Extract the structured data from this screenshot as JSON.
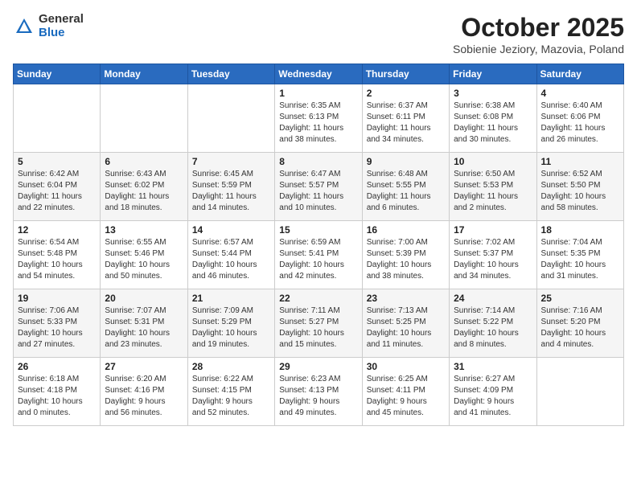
{
  "header": {
    "logo_general": "General",
    "logo_blue": "Blue",
    "month_title": "October 2025",
    "location": "Sobienie Jeziory, Mazovia, Poland"
  },
  "weekdays": [
    "Sunday",
    "Monday",
    "Tuesday",
    "Wednesday",
    "Thursday",
    "Friday",
    "Saturday"
  ],
  "weeks": [
    [
      {
        "day": "",
        "info": ""
      },
      {
        "day": "",
        "info": ""
      },
      {
        "day": "",
        "info": ""
      },
      {
        "day": "1",
        "info": "Sunrise: 6:35 AM\nSunset: 6:13 PM\nDaylight: 11 hours\nand 38 minutes."
      },
      {
        "day": "2",
        "info": "Sunrise: 6:37 AM\nSunset: 6:11 PM\nDaylight: 11 hours\nand 34 minutes."
      },
      {
        "day": "3",
        "info": "Sunrise: 6:38 AM\nSunset: 6:08 PM\nDaylight: 11 hours\nand 30 minutes."
      },
      {
        "day": "4",
        "info": "Sunrise: 6:40 AM\nSunset: 6:06 PM\nDaylight: 11 hours\nand 26 minutes."
      }
    ],
    [
      {
        "day": "5",
        "info": "Sunrise: 6:42 AM\nSunset: 6:04 PM\nDaylight: 11 hours\nand 22 minutes."
      },
      {
        "day": "6",
        "info": "Sunrise: 6:43 AM\nSunset: 6:02 PM\nDaylight: 11 hours\nand 18 minutes."
      },
      {
        "day": "7",
        "info": "Sunrise: 6:45 AM\nSunset: 5:59 PM\nDaylight: 11 hours\nand 14 minutes."
      },
      {
        "day": "8",
        "info": "Sunrise: 6:47 AM\nSunset: 5:57 PM\nDaylight: 11 hours\nand 10 minutes."
      },
      {
        "day": "9",
        "info": "Sunrise: 6:48 AM\nSunset: 5:55 PM\nDaylight: 11 hours\nand 6 minutes."
      },
      {
        "day": "10",
        "info": "Sunrise: 6:50 AM\nSunset: 5:53 PM\nDaylight: 11 hours\nand 2 minutes."
      },
      {
        "day": "11",
        "info": "Sunrise: 6:52 AM\nSunset: 5:50 PM\nDaylight: 10 hours\nand 58 minutes."
      }
    ],
    [
      {
        "day": "12",
        "info": "Sunrise: 6:54 AM\nSunset: 5:48 PM\nDaylight: 10 hours\nand 54 minutes."
      },
      {
        "day": "13",
        "info": "Sunrise: 6:55 AM\nSunset: 5:46 PM\nDaylight: 10 hours\nand 50 minutes."
      },
      {
        "day": "14",
        "info": "Sunrise: 6:57 AM\nSunset: 5:44 PM\nDaylight: 10 hours\nand 46 minutes."
      },
      {
        "day": "15",
        "info": "Sunrise: 6:59 AM\nSunset: 5:41 PM\nDaylight: 10 hours\nand 42 minutes."
      },
      {
        "day": "16",
        "info": "Sunrise: 7:00 AM\nSunset: 5:39 PM\nDaylight: 10 hours\nand 38 minutes."
      },
      {
        "day": "17",
        "info": "Sunrise: 7:02 AM\nSunset: 5:37 PM\nDaylight: 10 hours\nand 34 minutes."
      },
      {
        "day": "18",
        "info": "Sunrise: 7:04 AM\nSunset: 5:35 PM\nDaylight: 10 hours\nand 31 minutes."
      }
    ],
    [
      {
        "day": "19",
        "info": "Sunrise: 7:06 AM\nSunset: 5:33 PM\nDaylight: 10 hours\nand 27 minutes."
      },
      {
        "day": "20",
        "info": "Sunrise: 7:07 AM\nSunset: 5:31 PM\nDaylight: 10 hours\nand 23 minutes."
      },
      {
        "day": "21",
        "info": "Sunrise: 7:09 AM\nSunset: 5:29 PM\nDaylight: 10 hours\nand 19 minutes."
      },
      {
        "day": "22",
        "info": "Sunrise: 7:11 AM\nSunset: 5:27 PM\nDaylight: 10 hours\nand 15 minutes."
      },
      {
        "day": "23",
        "info": "Sunrise: 7:13 AM\nSunset: 5:25 PM\nDaylight: 10 hours\nand 11 minutes."
      },
      {
        "day": "24",
        "info": "Sunrise: 7:14 AM\nSunset: 5:22 PM\nDaylight: 10 hours\nand 8 minutes."
      },
      {
        "day": "25",
        "info": "Sunrise: 7:16 AM\nSunset: 5:20 PM\nDaylight: 10 hours\nand 4 minutes."
      }
    ],
    [
      {
        "day": "26",
        "info": "Sunrise: 6:18 AM\nSunset: 4:18 PM\nDaylight: 10 hours\nand 0 minutes."
      },
      {
        "day": "27",
        "info": "Sunrise: 6:20 AM\nSunset: 4:16 PM\nDaylight: 9 hours\nand 56 minutes."
      },
      {
        "day": "28",
        "info": "Sunrise: 6:22 AM\nSunset: 4:15 PM\nDaylight: 9 hours\nand 52 minutes."
      },
      {
        "day": "29",
        "info": "Sunrise: 6:23 AM\nSunset: 4:13 PM\nDaylight: 9 hours\nand 49 minutes."
      },
      {
        "day": "30",
        "info": "Sunrise: 6:25 AM\nSunset: 4:11 PM\nDaylight: 9 hours\nand 45 minutes."
      },
      {
        "day": "31",
        "info": "Sunrise: 6:27 AM\nSunset: 4:09 PM\nDaylight: 9 hours\nand 41 minutes."
      },
      {
        "day": "",
        "info": ""
      }
    ]
  ]
}
